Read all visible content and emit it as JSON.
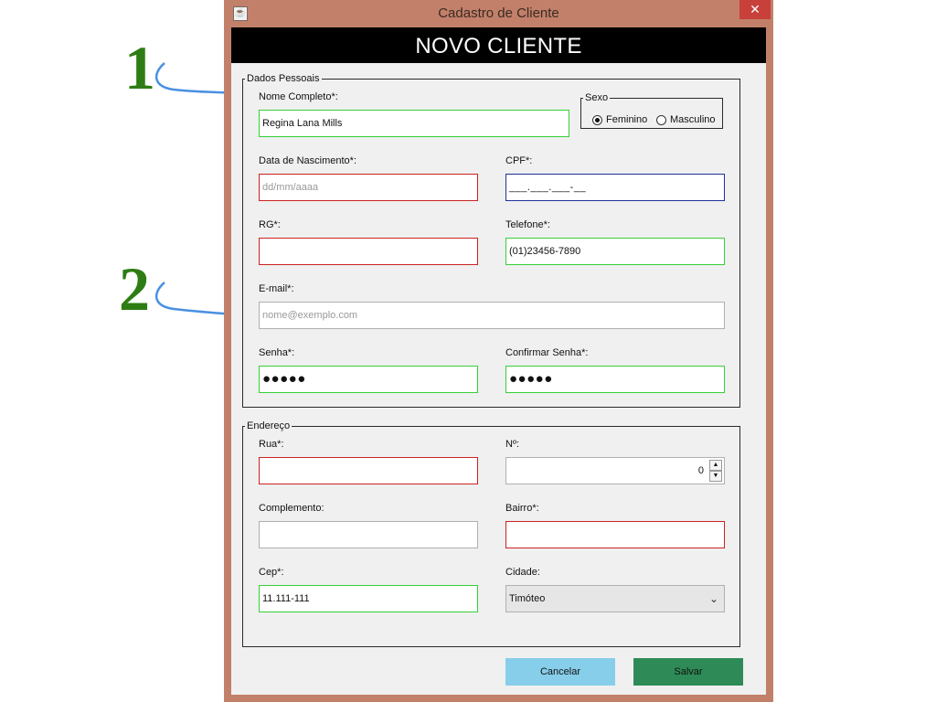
{
  "annotations": {
    "one": "1",
    "two": "2"
  },
  "window": {
    "title": "Cadastro de Cliente",
    "close_label": "✕",
    "app_icon": "java-icon"
  },
  "header": {
    "title": "NOVO CLIENTE"
  },
  "dados_pessoais": {
    "legend": "Dados Pessoais",
    "nome": {
      "label": "Nome Completo*:",
      "value": "Regina Lana Mills",
      "state": "valid"
    },
    "sexo": {
      "legend": "Sexo",
      "options": [
        {
          "label": "Feminino",
          "selected": true
        },
        {
          "label": "Masculino",
          "selected": false
        }
      ]
    },
    "nascimento": {
      "label": "Data de Nascimento*:",
      "placeholder": "dd/mm/aaaa",
      "state": "invalid"
    },
    "cpf": {
      "label": "CPF*:",
      "value": "___.___.___-__",
      "state": "focused"
    },
    "rg": {
      "label": "RG*:",
      "value": "",
      "state": "invalid"
    },
    "telefone": {
      "label": "Telefone*:",
      "value": "(01)23456-7890",
      "state": "valid"
    },
    "email": {
      "label": "E-mail*:",
      "placeholder": "nome@exemplo.com",
      "state": "neutral"
    },
    "senha": {
      "label": "Senha*:",
      "value": "●●●●●",
      "state": "valid"
    },
    "confirmar_senha": {
      "label": "Confirmar Senha*:",
      "value": "●●●●●",
      "state": "valid"
    }
  },
  "endereco": {
    "legend": "Endereço",
    "rua": {
      "label": "Rua*:",
      "value": "",
      "state": "invalid"
    },
    "numero": {
      "label": "Nº:",
      "value": "0",
      "up": "▲",
      "down": "▼"
    },
    "complemento": {
      "label": "Complemento:",
      "value": "",
      "state": "neutral"
    },
    "bairro": {
      "label": "Bairro*:",
      "value": "",
      "state": "invalid"
    },
    "cep": {
      "label": "Cep*:",
      "value": "11.111-111",
      "state": "valid"
    },
    "cidade": {
      "label": "Cidade:",
      "selected": "Timóteo",
      "chevron": "⌄"
    }
  },
  "actions": {
    "cancel": "Cancelar",
    "save": "Salvar"
  },
  "colors": {
    "valid": "#37d037",
    "invalid": "#cc2222",
    "focused": "#1f2f9a",
    "header_bg": "#000000",
    "window_frame": "#c2806a",
    "cancel_bg": "#87ceeb",
    "save_bg": "#2e8b57",
    "annotation": "#2e7d14"
  }
}
